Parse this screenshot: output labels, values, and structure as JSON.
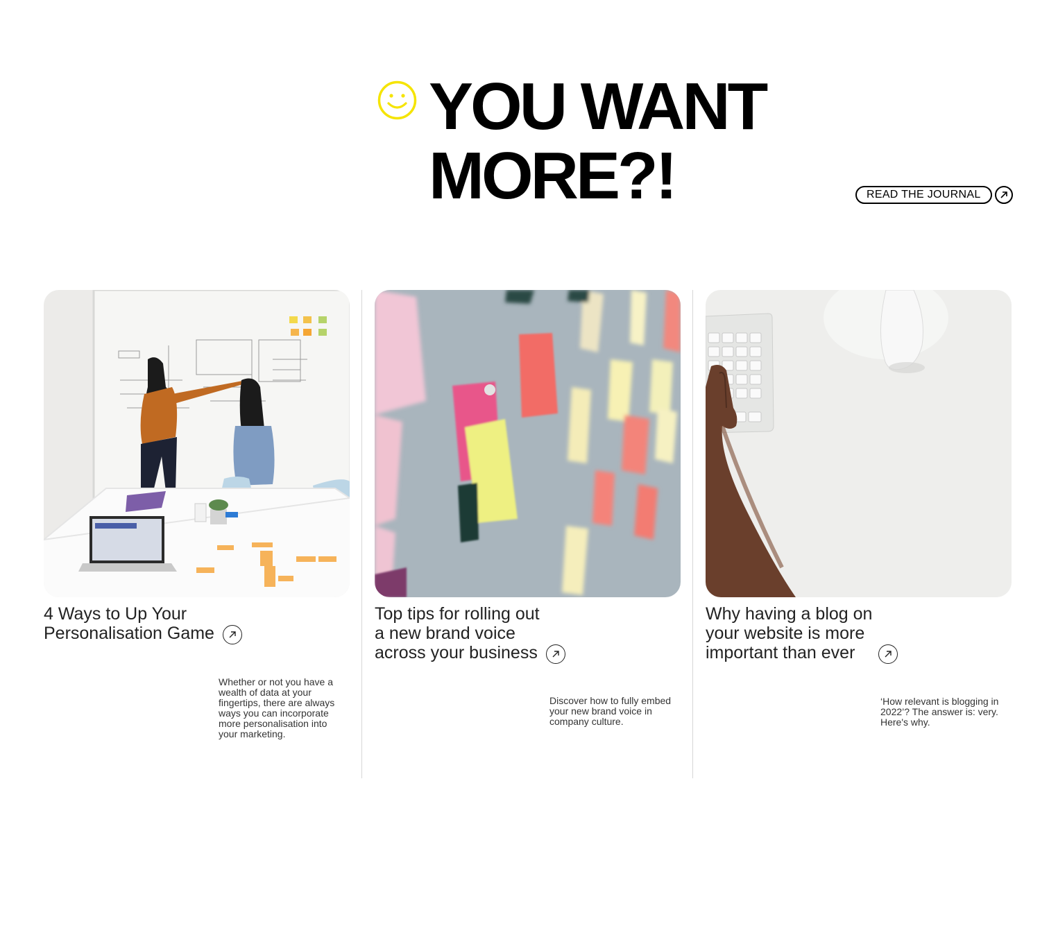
{
  "hero": {
    "icon": "smiley-icon",
    "title_line1": "YOU WANT",
    "title_line2": "MORE?!",
    "cta_label": "READ THE JOURNAL",
    "accent_color": "#f5e400"
  },
  "cards": [
    {
      "image": "office-whiteboard-photo",
      "title_line1": "4 Ways to Up Your",
      "title_line2": "Personalisation Game",
      "description": "Whether or not you have a wealth of data at your fingertips, there are always ways you can incorporate more personalisation into your marketing."
    },
    {
      "image": "sticky-notes-board-photo",
      "title_line1": "Top tips for rolling out",
      "title_line2": "a new brand voice",
      "title_line3": "across your business",
      "description": "Discover how to fully embed your new brand voice in company culture."
    },
    {
      "image": "keyboard-mouse-photo",
      "title_line1": "Why having a blog on",
      "title_line2": "your website is more",
      "title_line3": "important than ever",
      "description": "‘How relevant is blogging in 2022’? The answer is: very. Here's why."
    }
  ]
}
